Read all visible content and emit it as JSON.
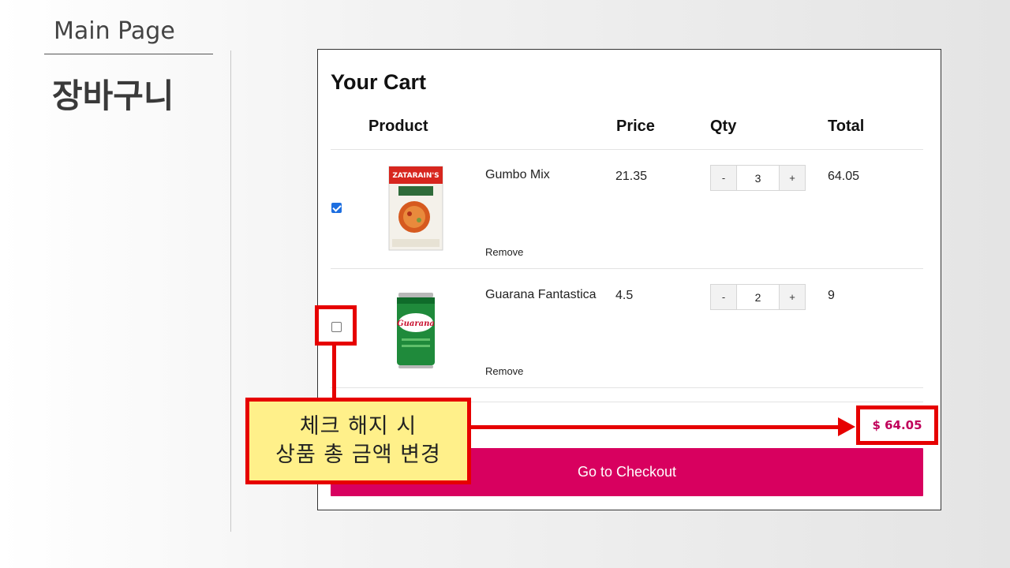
{
  "slide": {
    "header": "Main Page",
    "title": "장바구니"
  },
  "cart": {
    "title": "Your Cart",
    "columns": {
      "product": "Product",
      "price": "Price",
      "qty": "Qty",
      "total": "Total"
    },
    "items": [
      {
        "checked": true,
        "image": "zatarains-gumbo-mix-box",
        "image_label": "ZATARAIN'S",
        "name": "Gumbo Mix",
        "price": "21.35",
        "qty": "3",
        "total": "64.05",
        "remove_label": "Remove"
      },
      {
        "checked": false,
        "image": "guarana-antarctica-can",
        "image_label": "Guarana",
        "name": "Guarana Fantastica",
        "price": "4.5",
        "qty": "2",
        "total": "9",
        "remove_label": "Remove"
      }
    ],
    "qty_minus": "-",
    "qty_plus": "+",
    "grand_total": "$ 64.05",
    "checkout_label": "Go to Checkout"
  },
  "annotation": {
    "line1": "체크 해지 시",
    "line2": "상품 총 금액 변경"
  },
  "colors": {
    "accent": "#d8005f",
    "highlight_red": "#e60000",
    "callout_yellow": "#fff08a",
    "total_text": "#c0005a"
  }
}
